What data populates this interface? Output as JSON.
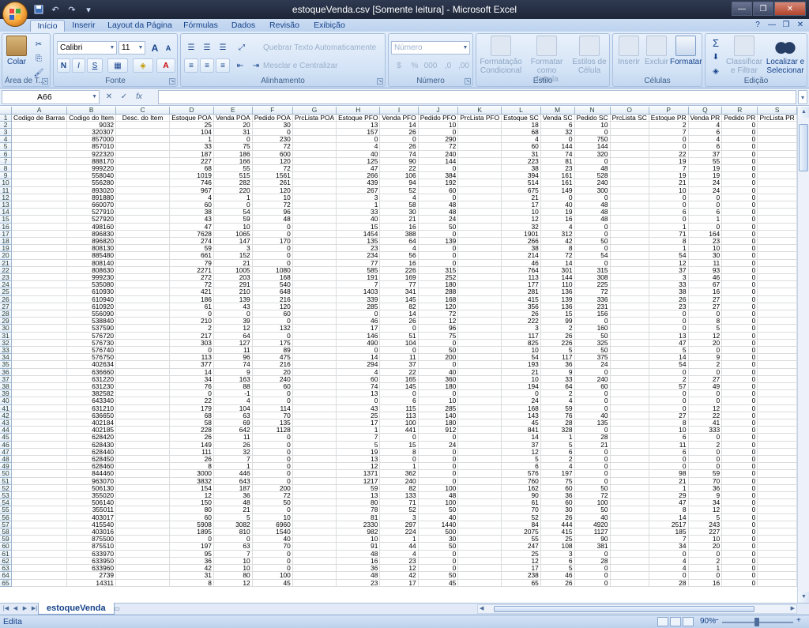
{
  "window": {
    "title": "estoqueVenda.csv  [Somente leitura] - Microsoft Excel",
    "controls": {
      "minimize": "—",
      "restore": "❐",
      "close": "✕"
    }
  },
  "qat": {
    "save": "💾",
    "undo": "↶",
    "redo": "↷",
    "customize": "▾"
  },
  "tabs": [
    "Início",
    "Inserir",
    "Layout da Página",
    "Fórmulas",
    "Dados",
    "Revisão",
    "Exibição"
  ],
  "help": {
    "help": "?",
    "minimize": "—",
    "restore": "❐",
    "close": "✕"
  },
  "ribbon": {
    "clipboard": {
      "label": "Área de T...",
      "paste": "Colar",
      "cut": "✂",
      "copy": "⎘",
      "format_painter": "🖌"
    },
    "font": {
      "label": "Fonte",
      "name": "Calibri",
      "size": "11",
      "grow": "A",
      "shrink": "A",
      "bold": "N",
      "italic": "I",
      "underline": "S",
      "borders": "▦",
      "fill": "◈",
      "color": "A"
    },
    "alignment": {
      "label": "Alinhamento",
      "wrap": "Quebrar Texto Automaticamente",
      "merge": "Mesclar e Centralizar"
    },
    "number": {
      "label": "Número",
      "format": "Número",
      "currency": "$",
      "percent": "%",
      "comma": "000",
      "inc": ",0",
      "dec": ",00"
    },
    "style": {
      "label": "Estilo",
      "conditional": "Formatação Condicional",
      "table": "Formatar como Tabela",
      "cell": "Estilos de Célula"
    },
    "cells": {
      "label": "Células",
      "insert": "Inserir",
      "delete": "Excluir",
      "format": "Formatar"
    },
    "editing": {
      "label": "Edição",
      "sum": "Σ",
      "fill": "⬇",
      "clear": "◈",
      "sort": "Classificar e Filtrar",
      "find": "Localizar e Selecionar"
    }
  },
  "formula_bar": {
    "name_box": "A66",
    "formula": "",
    "cancel": "✕",
    "enter": "✓",
    "fx": "fx"
  },
  "columns": [
    "A",
    "B",
    "C",
    "D",
    "E",
    "F",
    "G",
    "H",
    "I",
    "J",
    "K",
    "L",
    "M",
    "N",
    "O",
    "P",
    "Q",
    "R",
    "S"
  ],
  "header_row": [
    "Codigo de Barras",
    "Codigo do Item",
    "Desc. do Item",
    "Estoque POA",
    "Venda POA",
    "Pedido POA",
    "PrcLista POA",
    "Estoque PFO",
    "Venda PFO",
    "Pedido PFO",
    "PrcLista PFO",
    "Estoque SC",
    "Venda SC",
    "Pedido SC",
    "PrcLista SC",
    "Estoque PR",
    "Venda PR",
    "Pedido PR",
    "PrcLista PR"
  ],
  "rows": [
    [
      "9032",
      "25",
      "20",
      "30",
      "13",
      "14",
      "10",
      "18",
      "6",
      "10",
      "2",
      "4",
      "0"
    ],
    [
      "320307",
      "104",
      "31",
      "0",
      "157",
      "26",
      "0",
      "68",
      "32",
      "0",
      "7",
      "6",
      "0"
    ],
    [
      "857000",
      "1",
      "0",
      "230",
      "0",
      "0",
      "290",
      "4",
      "0",
      "750",
      "0",
      "4",
      "0"
    ],
    [
      "857010",
      "33",
      "75",
      "72",
      "4",
      "26",
      "72",
      "60",
      "144",
      "144",
      "0",
      "6",
      "0"
    ],
    [
      "922320",
      "187",
      "186",
      "600",
      "40",
      "74",
      "240",
      "31",
      "74",
      "320",
      "22",
      "37",
      "0"
    ],
    [
      "888170",
      "227",
      "166",
      "120",
      "125",
      "90",
      "144",
      "223",
      "81",
      "0",
      "19",
      "55",
      "0"
    ],
    [
      "999220",
      "68",
      "55",
      "72",
      "47",
      "22",
      "0",
      "38",
      "23",
      "48",
      "7",
      "19",
      "0"
    ],
    [
      "558040",
      "1019",
      "515",
      "1561",
      "266",
      "106",
      "384",
      "394",
      "161",
      "528",
      "19",
      "19",
      "0"
    ],
    [
      "556280",
      "746",
      "282",
      "261",
      "439",
      "94",
      "192",
      "514",
      "161",
      "240",
      "21",
      "24",
      "0"
    ],
    [
      "893020",
      "967",
      "220",
      "120",
      "267",
      "52",
      "60",
      "675",
      "149",
      "300",
      "10",
      "24",
      "0"
    ],
    [
      "891880",
      "4",
      "1",
      "10",
      "3",
      "4",
      "0",
      "21",
      "0",
      "0",
      "0",
      "0",
      "0"
    ],
    [
      "660070",
      "60",
      "0",
      "72",
      "1",
      "58",
      "48",
      "17",
      "40",
      "48",
      "0",
      "0",
      "0"
    ],
    [
      "527910",
      "38",
      "54",
      "96",
      "33",
      "30",
      "48",
      "10",
      "19",
      "48",
      "6",
      "6",
      "0"
    ],
    [
      "527920",
      "43",
      "59",
      "48",
      "40",
      "21",
      "24",
      "12",
      "16",
      "48",
      "0",
      "1",
      "0"
    ],
    [
      "498160",
      "47",
      "10",
      "0",
      "15",
      "16",
      "50",
      "32",
      "4",
      "0",
      "1",
      "0",
      "0"
    ],
    [
      "896830",
      "7628",
      "1065",
      "0",
      "1454",
      "388",
      "0",
      "1901",
      "312",
      "0",
      "71",
      "164",
      "0"
    ],
    [
      "896820",
      "274",
      "147",
      "170",
      "135",
      "64",
      "139",
      "266",
      "42",
      "50",
      "8",
      "23",
      "0"
    ],
    [
      "808130",
      "59",
      "3",
      "0",
      "23",
      "4",
      "0",
      "38",
      "8",
      "0",
      "1",
      "10",
      "0"
    ],
    [
      "885480",
      "661",
      "152",
      "0",
      "234",
      "56",
      "0",
      "214",
      "72",
      "54",
      "54",
      "30",
      "0"
    ],
    [
      "808140",
      "79",
      "21",
      "0",
      "77",
      "16",
      "0",
      "46",
      "14",
      "0",
      "12",
      "11",
      "0"
    ],
    [
      "808630",
      "2271",
      "1005",
      "1080",
      "585",
      "226",
      "315",
      "764",
      "301",
      "315",
      "37",
      "93",
      "0"
    ],
    [
      "999230",
      "272",
      "203",
      "168",
      "191",
      "169",
      "252",
      "113",
      "144",
      "308",
      "3",
      "46",
      "0"
    ],
    [
      "535080",
      "72",
      "291",
      "540",
      "7",
      "77",
      "180",
      "177",
      "110",
      "225",
      "33",
      "67",
      "0"
    ],
    [
      "610930",
      "421",
      "210",
      "648",
      "1403",
      "341",
      "288",
      "281",
      "136",
      "72",
      "38",
      "16",
      "0"
    ],
    [
      "610940",
      "186",
      "139",
      "216",
      "339",
      "145",
      "168",
      "415",
      "139",
      "336",
      "26",
      "27",
      "0"
    ],
    [
      "610920",
      "61",
      "43",
      "120",
      "285",
      "82",
      "120",
      "356",
      "136",
      "231",
      "23",
      "27",
      "0"
    ],
    [
      "556090",
      "0",
      "0",
      "60",
      "0",
      "14",
      "72",
      "26",
      "15",
      "156",
      "0",
      "0",
      "0"
    ],
    [
      "538840",
      "210",
      "39",
      "0",
      "46",
      "26",
      "12",
      "222",
      "99",
      "0",
      "0",
      "8",
      "0"
    ],
    [
      "537590",
      "2",
      "12",
      "132",
      "17",
      "0",
      "96",
      "3",
      "2",
      "160",
      "0",
      "5",
      "0"
    ],
    [
      "576720",
      "217",
      "64",
      "0",
      "146",
      "51",
      "75",
      "117",
      "26",
      "50",
      "13",
      "12",
      "0"
    ],
    [
      "576730",
      "303",
      "127",
      "175",
      "490",
      "104",
      "0",
      "825",
      "226",
      "325",
      "47",
      "20",
      "0"
    ],
    [
      "576740",
      "0",
      "11",
      "89",
      "0",
      "0",
      "50",
      "10",
      "5",
      "50",
      "5",
      "0",
      "0"
    ],
    [
      "576750",
      "113",
      "96",
      "475",
      "14",
      "11",
      "200",
      "54",
      "117",
      "375",
      "14",
      "9",
      "0"
    ],
    [
      "402634",
      "377",
      "74",
      "216",
      "294",
      "37",
      "0",
      "193",
      "36",
      "24",
      "54",
      "2",
      "0"
    ],
    [
      "636660",
      "14",
      "9",
      "20",
      "4",
      "22",
      "40",
      "21",
      "9",
      "0",
      "0",
      "0",
      "0"
    ],
    [
      "631220",
      "34",
      "163",
      "240",
      "60",
      "165",
      "360",
      "10",
      "33",
      "240",
      "2",
      "27",
      "0"
    ],
    [
      "631230",
      "76",
      "88",
      "60",
      "74",
      "145",
      "180",
      "194",
      "64",
      "60",
      "57",
      "49",
      "0"
    ],
    [
      "382582",
      "0",
      "-1",
      "0",
      "13",
      "0",
      "0",
      "0",
      "2",
      "0",
      "0",
      "0",
      "0"
    ],
    [
      "643340",
      "22",
      "4",
      "0",
      "0",
      "6",
      "10",
      "24",
      "4",
      "0",
      "0",
      "0",
      "0"
    ],
    [
      "631210",
      "179",
      "104",
      "114",
      "43",
      "115",
      "285",
      "168",
      "59",
      "0",
      "0",
      "12",
      "0"
    ],
    [
      "636650",
      "68",
      "63",
      "70",
      "25",
      "113",
      "140",
      "143",
      "76",
      "40",
      "27",
      "22",
      "0"
    ],
    [
      "402184",
      "58",
      "69",
      "135",
      "17",
      "100",
      "180",
      "45",
      "28",
      "135",
      "8",
      "41",
      "0"
    ],
    [
      "402185",
      "228",
      "642",
      "1128",
      "1",
      "441",
      "912",
      "841",
      "328",
      "0",
      "10",
      "333",
      "0"
    ],
    [
      "628420",
      "26",
      "11",
      "0",
      "7",
      "0",
      "0",
      "14",
      "1",
      "28",
      "6",
      "0",
      "0"
    ],
    [
      "628430",
      "149",
      "26",
      "0",
      "5",
      "15",
      "24",
      "37",
      "5",
      "21",
      "11",
      "2",
      "0"
    ],
    [
      "628440",
      "111",
      "32",
      "0",
      "19",
      "8",
      "0",
      "12",
      "6",
      "0",
      "6",
      "0",
      "0"
    ],
    [
      "628450",
      "26",
      "7",
      "0",
      "13",
      "0",
      "0",
      "5",
      "2",
      "0",
      "0",
      "0",
      "0"
    ],
    [
      "628460",
      "8",
      "1",
      "0",
      "12",
      "1",
      "0",
      "6",
      "4",
      "0",
      "0",
      "0",
      "0"
    ],
    [
      "844460",
      "3000",
      "446",
      "0",
      "1371",
      "362",
      "0",
      "576",
      "197",
      "0",
      "98",
      "59",
      "0"
    ],
    [
      "963070",
      "3832",
      "643",
      "0",
      "1217",
      "240",
      "0",
      "760",
      "75",
      "0",
      "21",
      "70",
      "0"
    ],
    [
      "506130",
      "154",
      "187",
      "200",
      "59",
      "82",
      "100",
      "162",
      "60",
      "50",
      "1",
      "36",
      "0"
    ],
    [
      "355020",
      "12",
      "36",
      "72",
      "13",
      "133",
      "48",
      "90",
      "36",
      "72",
      "29",
      "9",
      "0"
    ],
    [
      "506140",
      "150",
      "48",
      "50",
      "80",
      "71",
      "100",
      "61",
      "60",
      "100",
      "47",
      "34",
      "0"
    ],
    [
      "355011",
      "80",
      "21",
      "0",
      "78",
      "52",
      "50",
      "70",
      "30",
      "50",
      "8",
      "12",
      "0"
    ],
    [
      "403017",
      "60",
      "5",
      "10",
      "81",
      "3",
      "40",
      "52",
      "26",
      "40",
      "14",
      "5",
      "0"
    ],
    [
      "415540",
      "5908",
      "3082",
      "6960",
      "2330",
      "297",
      "1440",
      "84",
      "444",
      "4920",
      "2517",
      "243",
      "0"
    ],
    [
      "403016",
      "1895",
      "810",
      "1540",
      "982",
      "224",
      "500",
      "2075",
      "415",
      "1127",
      "185",
      "227",
      "0"
    ],
    [
      "875500",
      "0",
      "0",
      "40",
      "10",
      "1",
      "30",
      "55",
      "25",
      "90",
      "7",
      "10",
      "0"
    ],
    [
      "875510",
      "197",
      "63",
      "70",
      "91",
      "44",
      "50",
      "247",
      "108",
      "381",
      "34",
      "20",
      "0"
    ],
    [
      "633970",
      "95",
      "7",
      "0",
      "48",
      "4",
      "0",
      "25",
      "3",
      "0",
      "0",
      "0",
      "0"
    ],
    [
      "633950",
      "36",
      "10",
      "0",
      "16",
      "23",
      "0",
      "12",
      "6",
      "28",
      "4",
      "2",
      "0"
    ],
    [
      "633960",
      "42",
      "10",
      "0",
      "36",
      "12",
      "0",
      "17",
      "5",
      "0",
      "4",
      "1",
      "0"
    ],
    [
      "2739",
      "31",
      "80",
      "100",
      "48",
      "42",
      "50",
      "238",
      "46",
      "0",
      "0",
      "0",
      "0"
    ],
    [
      "14311",
      "8",
      "12",
      "45",
      "23",
      "17",
      "45",
      "65",
      "26",
      "0",
      "28",
      "16",
      "0"
    ]
  ],
  "sheet_tabs": {
    "name": "estoqueVenda",
    "nav": [
      "|◀",
      "◀",
      "▶",
      "▶|"
    ]
  },
  "status": {
    "mode": "Edita",
    "zoom": "90%",
    "zoom_minus": "−",
    "zoom_plus": "+"
  }
}
